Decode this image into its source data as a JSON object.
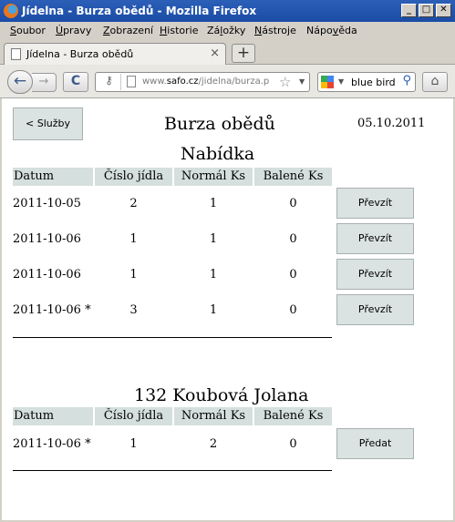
{
  "window": {
    "title": "Jídelna - Burza obědů - Mozilla Firefox",
    "minimize": "_",
    "maximize": "□",
    "close": "✕"
  },
  "menu": {
    "items": [
      {
        "pre": "",
        "key": "S",
        "post": "oubor"
      },
      {
        "pre": "",
        "key": "Ú",
        "post": "pravy"
      },
      {
        "pre": "",
        "key": "Z",
        "post": "obrazení"
      },
      {
        "pre": "",
        "key": "H",
        "post": "istorie"
      },
      {
        "pre": "Zá",
        "key": "l",
        "post": "ožky"
      },
      {
        "pre": "",
        "key": "N",
        "post": "ástroje"
      },
      {
        "pre": "Nápo",
        "key": "v",
        "post": "ěda"
      }
    ]
  },
  "tabs": {
    "active_title": "Jídelna - Burza obědů",
    "close_glyph": "×",
    "new_tab_glyph": "+"
  },
  "nav": {
    "back_glyph": "←",
    "forward_glyph": "→",
    "reload_glyph": "C",
    "url_prefix": "www.",
    "url_domain": "safo.cz",
    "url_path": "/jidelna/burza.p",
    "search_query": "blue bird",
    "search_engine_icon": "google-icon",
    "home_glyph": "⌂"
  },
  "page": {
    "back_button": "<  Služby",
    "title": "Burza obědů",
    "date": "05.10.2011",
    "offer_title": "Nabídka",
    "columns": [
      "Datum",
      "Číslo jídla",
      "Normál Ks",
      "Balené Ks"
    ],
    "offers": [
      {
        "date": "2011-10-05",
        "meal": "2",
        "normal": "1",
        "packed": "0",
        "action": "Převzít"
      },
      {
        "date": "2011-10-06",
        "meal": "1",
        "normal": "1",
        "packed": "0",
        "action": "Převzít"
      },
      {
        "date": "2011-10-06",
        "meal": "1",
        "normal": "1",
        "packed": "0",
        "action": "Převzít"
      },
      {
        "date": "2011-10-06 *",
        "meal": "3",
        "normal": "1",
        "packed": "0",
        "action": "Převzít"
      }
    ],
    "user_title": "132 Koubová Jolana",
    "mine": [
      {
        "date": "2011-10-06 *",
        "meal": "1",
        "normal": "2",
        "packed": "0",
        "action": "Předat"
      }
    ]
  }
}
